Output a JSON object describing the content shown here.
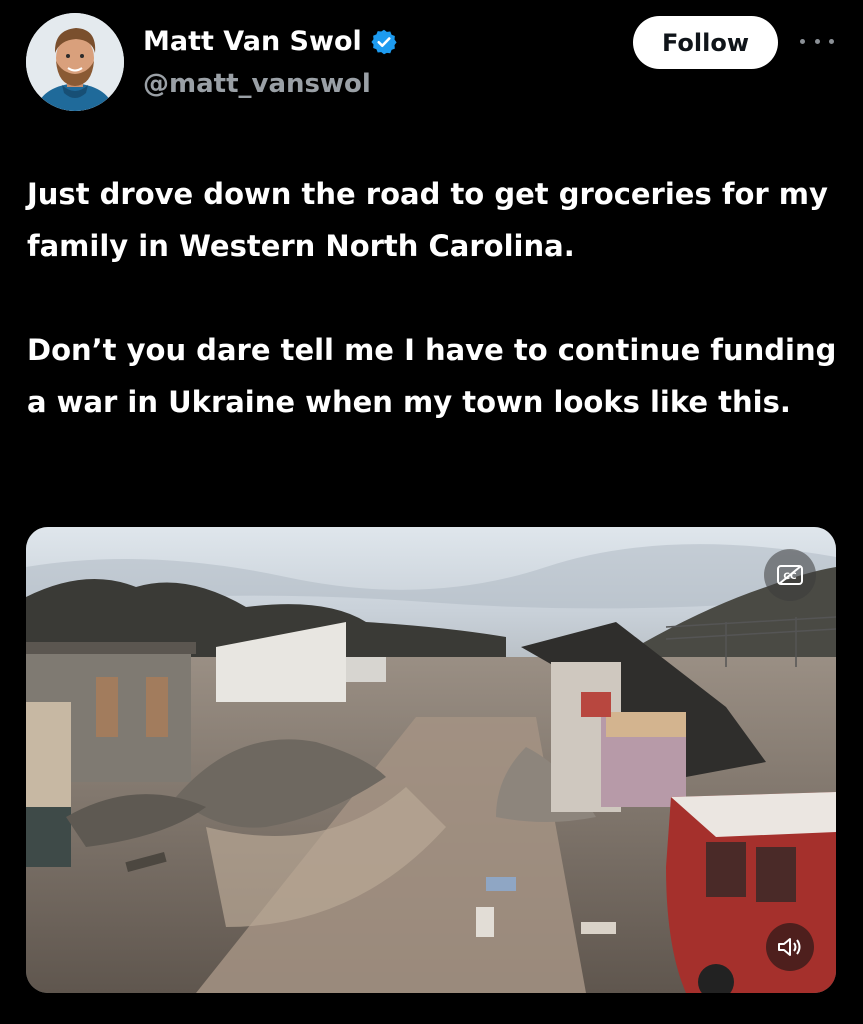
{
  "author": {
    "display_name": "Matt Van Swol",
    "handle": "@matt_vanswol",
    "verified_icon": "verified-badge-icon"
  },
  "actions": {
    "follow_label": "Follow",
    "more_icon": "more-options-icon"
  },
  "tweet": {
    "paragraphs": [
      "Just drove down the road to get groceries for my family in Western North Carolina.",
      "Don’t you dare tell me I have to continue funding a war in Ukraine when my town looks like this."
    ]
  },
  "media": {
    "type": "video",
    "captions_icon": "closed-captions-icon",
    "volume_icon": "speaker-muted-icon"
  },
  "colors": {
    "background": "#000000",
    "text": "#ffffff",
    "secondary_text": "#9aa0a6",
    "verified_blue": "#1d9bf0",
    "follow_bg": "#ffffff"
  }
}
